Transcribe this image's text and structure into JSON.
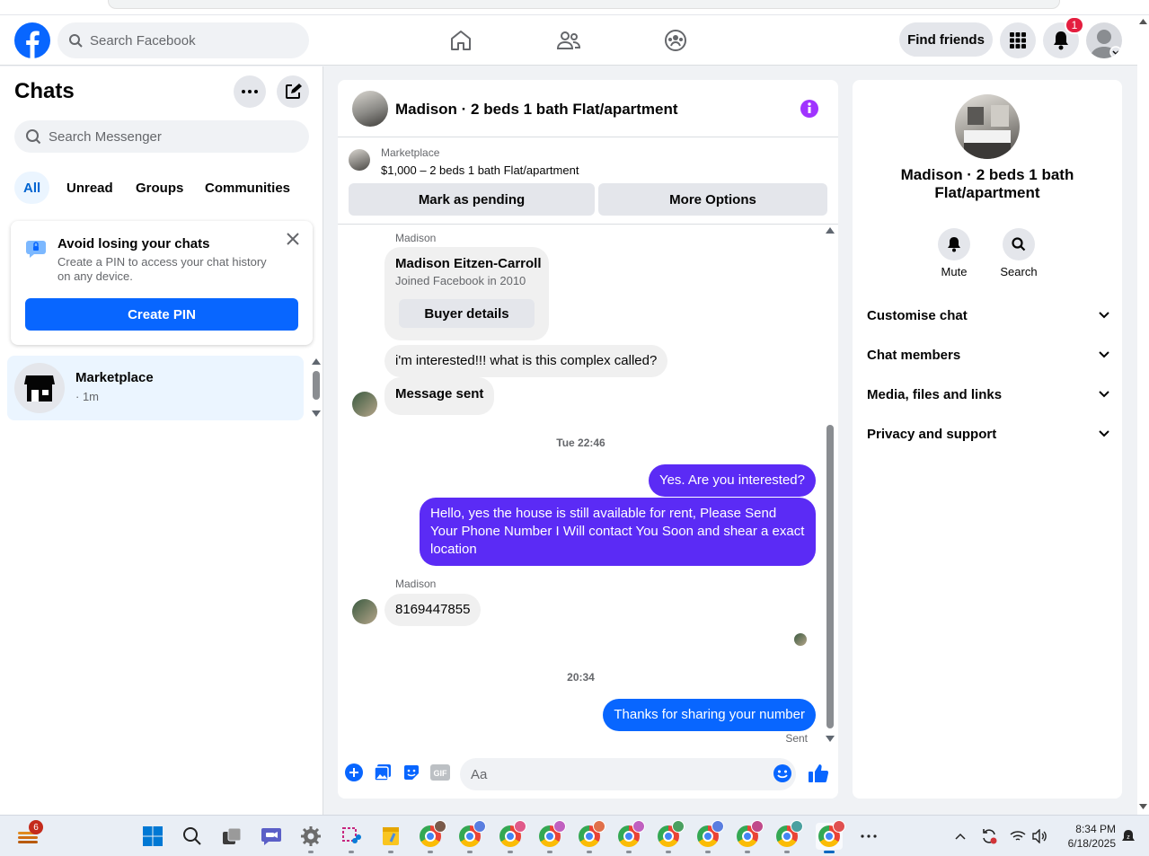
{
  "header": {
    "search_placeholder": "Search Facebook",
    "find_friends": "Find friends",
    "notification_count": "1"
  },
  "left": {
    "title": "Chats",
    "search_placeholder": "Search Messenger",
    "filters": [
      "All",
      "Unread",
      "Groups",
      "Communities"
    ],
    "pin_card": {
      "title": "Avoid losing your chats",
      "body": "Create a PIN to access your chat history on any device.",
      "button": "Create PIN"
    },
    "conversation": {
      "name": "Marketplace",
      "meta": "· 1m"
    }
  },
  "chat": {
    "title": "Madison · 2 beds 1 bath Flat/apartment",
    "marketplace_label": "Marketplace",
    "listing": "$1,000 – 2 beds 1 bath Flat/apartment",
    "mark_pending": "Mark as pending",
    "more_options": "More Options",
    "buyer_card": {
      "sender": "Madison",
      "name": "Madison Eitzen-Carroll",
      "joined": "Joined Facebook in 2010",
      "button": "Buyer details"
    },
    "msg_interested": "i'm interested!!! what is this complex called?",
    "msg_sent": "Message sent",
    "ts1": "Tue 22:46",
    "out1": "Yes. Are you interested?",
    "out2": "Hello, yes the house is still available for rent, Please Send Your Phone Number I Will contact You Soon and shear a exact location",
    "sender2": "Madison",
    "msg_number": "8169447855",
    "ts2": "20:34",
    "out3": "Thanks for sharing your number",
    "status": "Sent",
    "composer_placeholder": "Aa"
  },
  "right": {
    "name": "Madison · 2 beds 1 bath Flat/apartment",
    "mute": "Mute",
    "search": "Search",
    "sections": [
      "Customise chat",
      "Chat members",
      "Media, files and links",
      "Privacy and support"
    ]
  },
  "taskbar": {
    "widget_badge": "6",
    "time": "8:34 PM",
    "date": "6/18/2025"
  },
  "colors": {
    "fb_blue": "#0866ff",
    "outgoing_purple": "#5b2bf5",
    "info_purple": "#a033ff"
  }
}
